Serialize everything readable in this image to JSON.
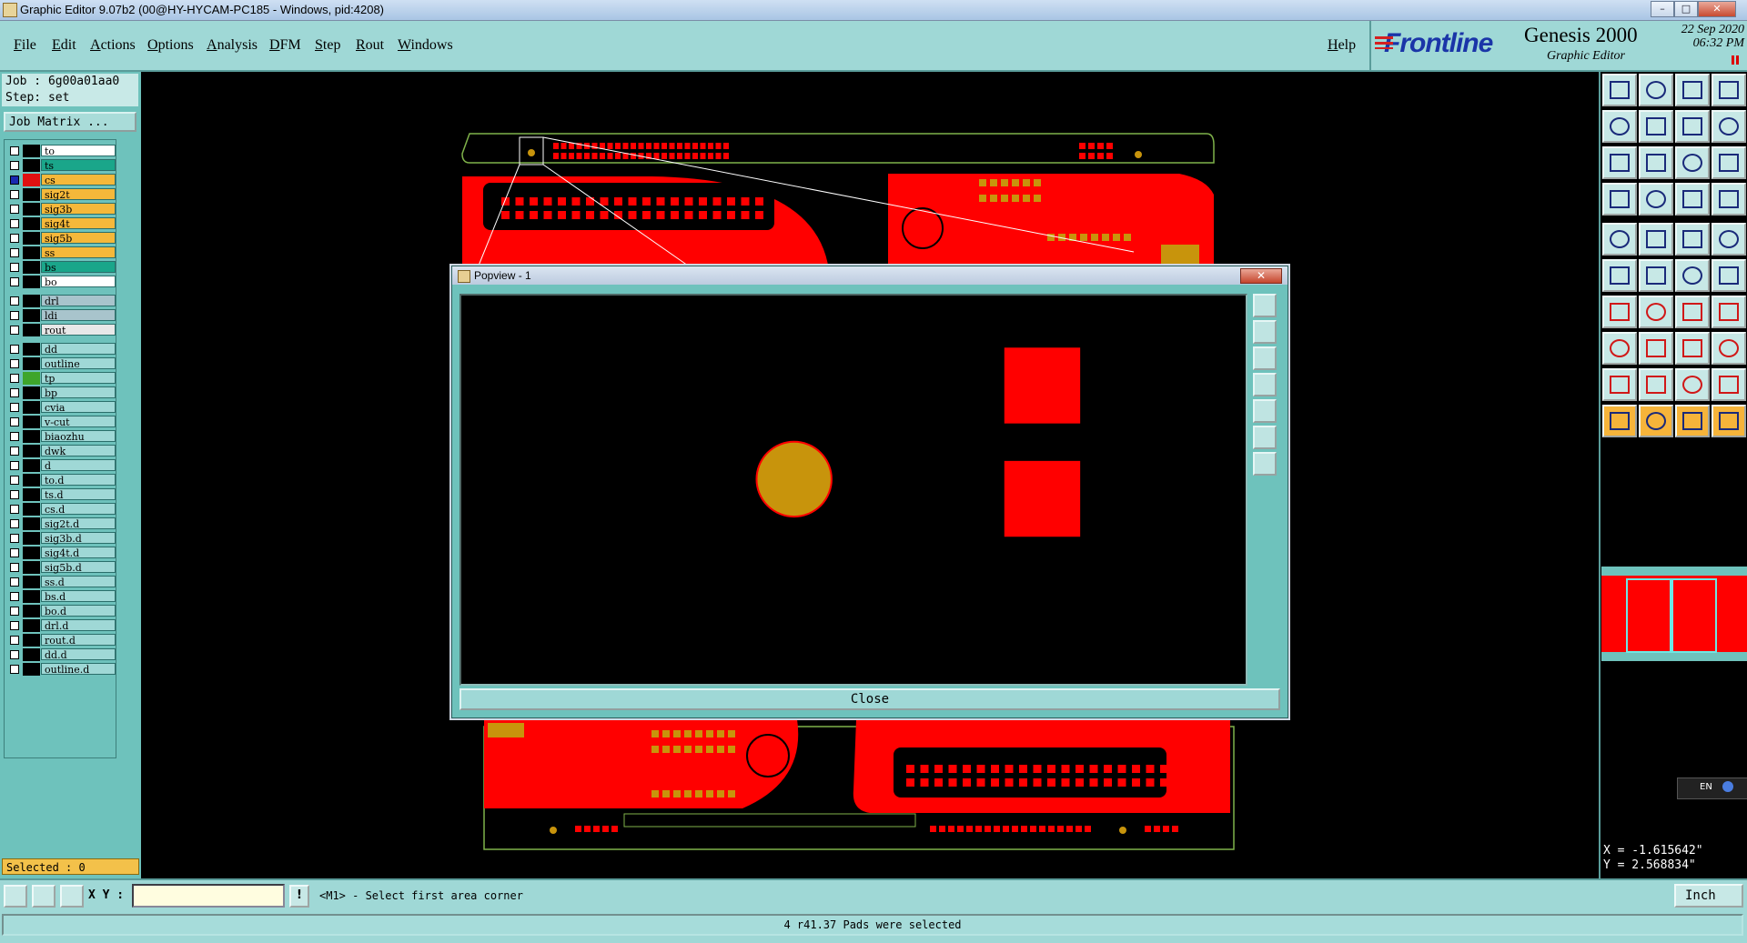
{
  "window": {
    "title": "Graphic Editor 9.07b2 (00@HY-HYCAM-PC185 - Windows, pid:4208)"
  },
  "menu": [
    "File",
    "Edit",
    "Actions",
    "Options",
    "Analysis",
    "DFM",
    "Step",
    "Rout",
    "Windows"
  ],
  "help_label": "Help",
  "brand": {
    "logo": "Frontline",
    "product": "Genesis 2000",
    "subtitle": "Graphic Editor",
    "date": "22 Sep 2020",
    "time": "06:32 PM"
  },
  "job": {
    "job_line": "Job : 6g00a01aa0",
    "step_line": "Step: set",
    "matrix_button": "Job Matrix ..."
  },
  "layers": [
    {
      "name": "to",
      "color": "#ffffff",
      "swatch": "#000000"
    },
    {
      "name": "ts",
      "color": "#1aa68a",
      "swatch": "#000000"
    },
    {
      "name": "cs",
      "color": "#f5b83a",
      "swatch": "#e01010",
      "active": true
    },
    {
      "name": "sig2t",
      "color": "#f5b83a",
      "swatch": "#000000"
    },
    {
      "name": "sig3b",
      "color": "#f5b83a",
      "swatch": "#000000"
    },
    {
      "name": "sig4t",
      "color": "#f5b83a",
      "swatch": "#000000"
    },
    {
      "name": "sig5b",
      "color": "#f5b83a",
      "swatch": "#000000"
    },
    {
      "name": "ss",
      "color": "#f5b83a",
      "swatch": "#000000"
    },
    {
      "name": "bs",
      "color": "#1aa68a",
      "swatch": "#000000"
    },
    {
      "name": "bo",
      "color": "#ffffff",
      "swatch": "#000000"
    },
    {
      "name": "drl",
      "color": "#a8c4cc",
      "swatch": "#000000",
      "gap": true
    },
    {
      "name": "ldi",
      "color": "#a8c4cc",
      "swatch": "#000000"
    },
    {
      "name": "rout",
      "color": "#e8e8e8",
      "swatch": "#000000"
    },
    {
      "name": "dd",
      "color": "#9fd8d6",
      "swatch": "#000000",
      "gap": true
    },
    {
      "name": "outline",
      "color": "#9fd8d6",
      "swatch": "#000000"
    },
    {
      "name": "tp",
      "color": "#9fd8d6",
      "swatch": "#3ea52b"
    },
    {
      "name": "bp",
      "color": "#9fd8d6",
      "swatch": "#000000"
    },
    {
      "name": "cvia",
      "color": "#9fd8d6",
      "swatch": "#000000"
    },
    {
      "name": "v-cut",
      "color": "#9fd8d6",
      "swatch": "#000000"
    },
    {
      "name": "biaozhu",
      "color": "#9fd8d6",
      "swatch": "#000000"
    },
    {
      "name": "dwk",
      "color": "#9fd8d6",
      "swatch": "#000000"
    },
    {
      "name": "d",
      "color": "#9fd8d6",
      "swatch": "#000000"
    },
    {
      "name": "to.d",
      "color": "#9fd8d6",
      "swatch": "#000000"
    },
    {
      "name": "ts.d",
      "color": "#9fd8d6",
      "swatch": "#000000"
    },
    {
      "name": "cs.d",
      "color": "#9fd8d6",
      "swatch": "#000000"
    },
    {
      "name": "sig2t.d",
      "color": "#9fd8d6",
      "swatch": "#000000"
    },
    {
      "name": "sig3b.d",
      "color": "#9fd8d6",
      "swatch": "#000000"
    },
    {
      "name": "sig4t.d",
      "color": "#9fd8d6",
      "swatch": "#000000"
    },
    {
      "name": "sig5b.d",
      "color": "#9fd8d6",
      "swatch": "#000000"
    },
    {
      "name": "ss.d",
      "color": "#9fd8d6",
      "swatch": "#000000"
    },
    {
      "name": "bs.d",
      "color": "#9fd8d6",
      "swatch": "#000000"
    },
    {
      "name": "bo.d",
      "color": "#9fd8d6",
      "swatch": "#000000"
    },
    {
      "name": "drl.d",
      "color": "#9fd8d6",
      "swatch": "#000000"
    },
    {
      "name": "rout.d",
      "color": "#9fd8d6",
      "swatch": "#000000"
    },
    {
      "name": "dd.d",
      "color": "#9fd8d6",
      "swatch": "#000000"
    },
    {
      "name": "outline.d",
      "color": "#9fd8d6",
      "swatch": "#000000"
    }
  ],
  "selected": "Selected : 0",
  "popview": {
    "title": "Popview - 1",
    "close_label": "Close"
  },
  "coords": {
    "x": "X = -1.615642\"",
    "y": "Y = 2.568834\""
  },
  "ime": {
    "lang": "EN"
  },
  "cmd": {
    "xy_label": "X Y :",
    "xy_value": "",
    "prompt": "<M1> - Select first area corner",
    "unit": "Inch"
  },
  "status": "4 r41.37 Pads were selected",
  "colors": {
    "copper": "#ff0000",
    "pad": "#c8940c",
    "outline": "#7fb24a",
    "panel": "#9fd8d6"
  }
}
